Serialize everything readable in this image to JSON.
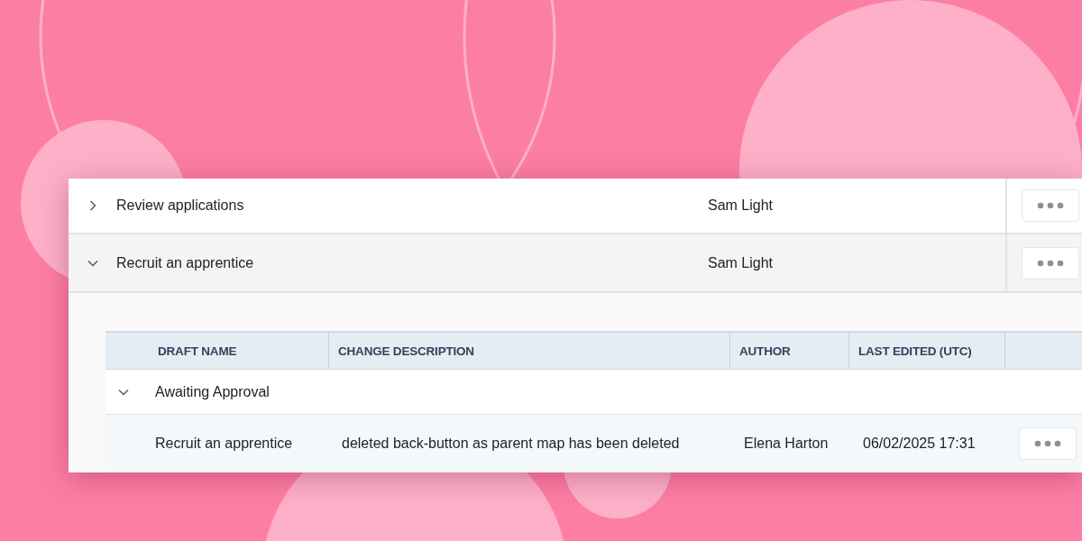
{
  "tasks": [
    {
      "name": "Review applications",
      "owner": "Sam Light",
      "expanded": false
    },
    {
      "name": "Recruit an apprentice",
      "owner": "Sam Light",
      "expanded": true,
      "drafts": {
        "columns": [
          "DRAFT NAME",
          "CHANGE DESCRIPTION",
          "AUTHOR",
          "LAST EDITED (UTC)"
        ],
        "groups": [
          {
            "label": "Awaiting Approval",
            "expanded": true,
            "rows": [
              {
                "draft_name": "Recruit an apprentice",
                "change_description": "deleted back-button as parent map has been deleted",
                "author": "Elena Harton",
                "last_edited": "06/02/2025 17:31"
              }
            ]
          }
        ]
      }
    }
  ]
}
